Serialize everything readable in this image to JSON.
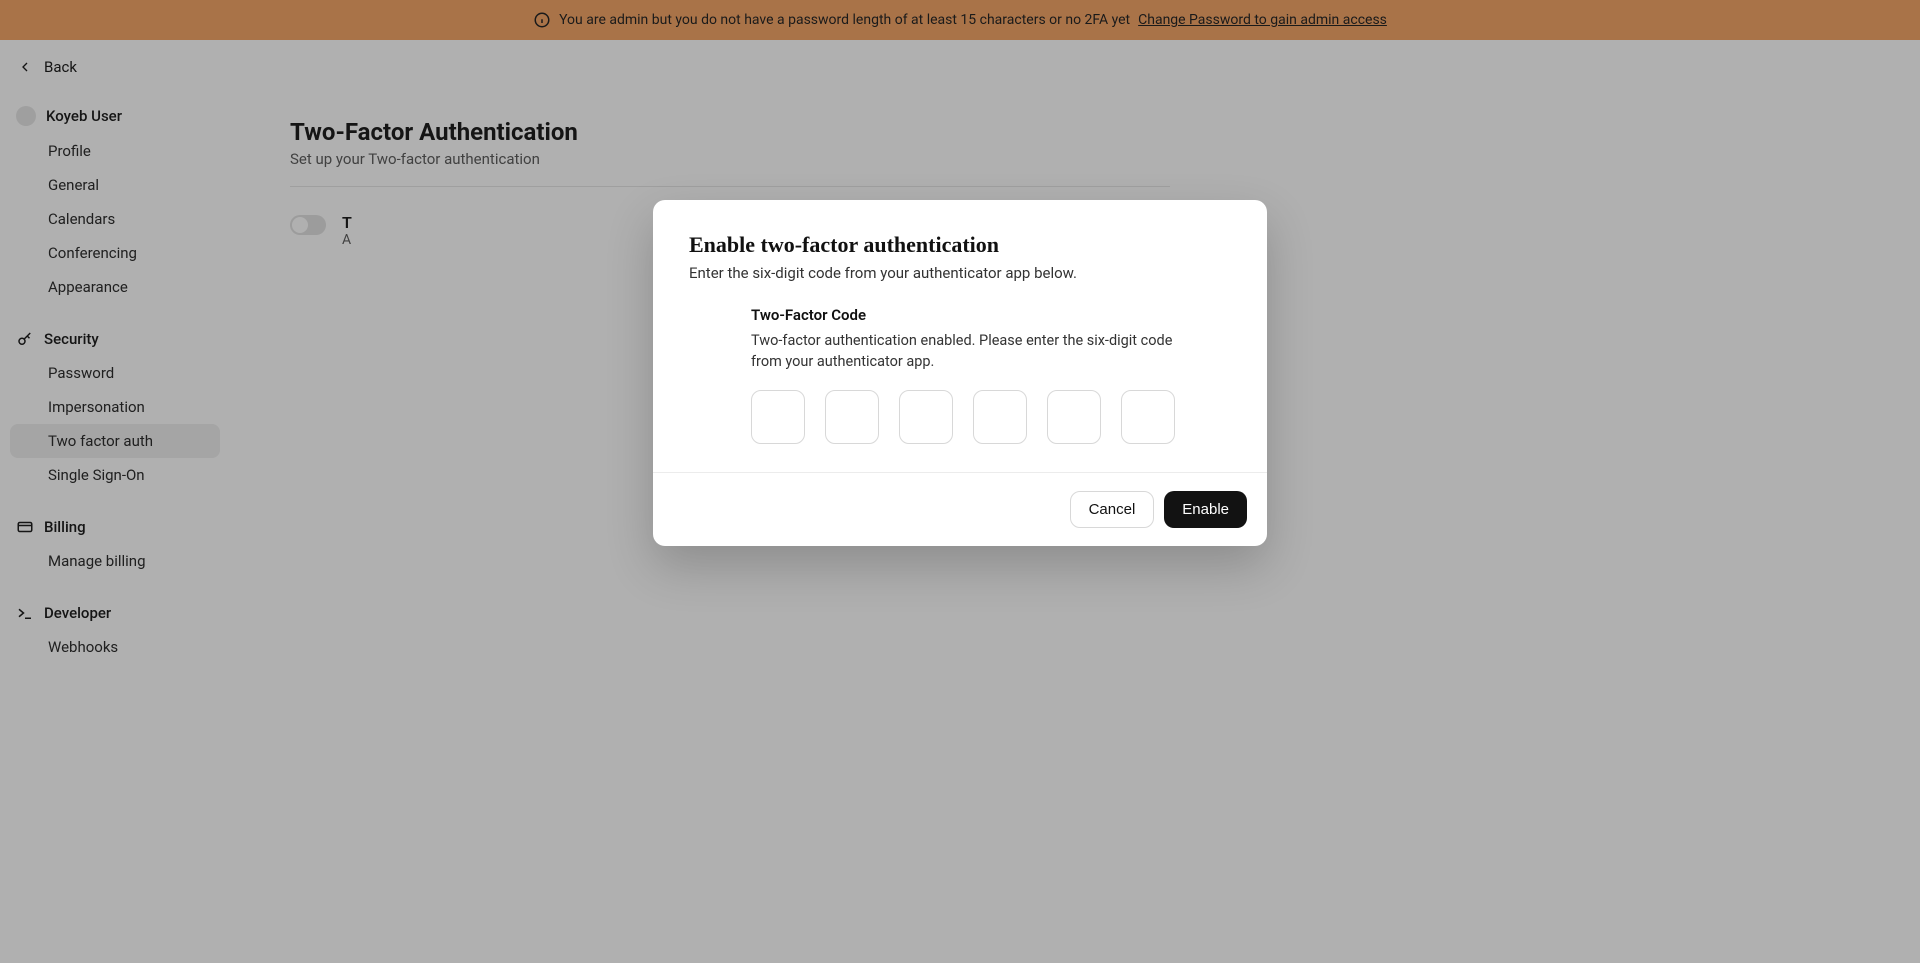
{
  "banner": {
    "text": "You are admin but you do not have a password length of at least 15 characters or no 2FA yet",
    "link": "Change Password to gain admin access"
  },
  "back": {
    "label": "Back"
  },
  "user": {
    "name": "Koyeb User"
  },
  "sidebar": {
    "groups": [
      {
        "header": "Koyeb User",
        "icon": "avatar",
        "items": [
          {
            "label": "Profile"
          },
          {
            "label": "General"
          },
          {
            "label": "Calendars"
          },
          {
            "label": "Conferencing"
          },
          {
            "label": "Appearance"
          }
        ]
      },
      {
        "header": "Security",
        "icon": "key",
        "items": [
          {
            "label": "Password"
          },
          {
            "label": "Impersonation"
          },
          {
            "label": "Two factor auth",
            "active": true
          },
          {
            "label": "Single Sign-On"
          }
        ]
      },
      {
        "header": "Billing",
        "icon": "credit-card",
        "items": [
          {
            "label": "Manage billing"
          }
        ]
      },
      {
        "header": "Developer",
        "icon": "terminal",
        "items": [
          {
            "label": "Webhooks"
          }
        ]
      }
    ]
  },
  "page": {
    "title": "Two-Factor Authentication",
    "subtitle": "Set up your Two-factor authentication",
    "toggle_title": "T",
    "toggle_sub": "A"
  },
  "modal": {
    "title": "Enable two-factor authentication",
    "subtitle": "Enter the six-digit code from your authenticator app below.",
    "field_label": "Two-Factor Code",
    "field_desc": "Two-factor authentication enabled. Please enter the six-digit code from your authenticator app.",
    "cancel": "Cancel",
    "enable": "Enable"
  }
}
